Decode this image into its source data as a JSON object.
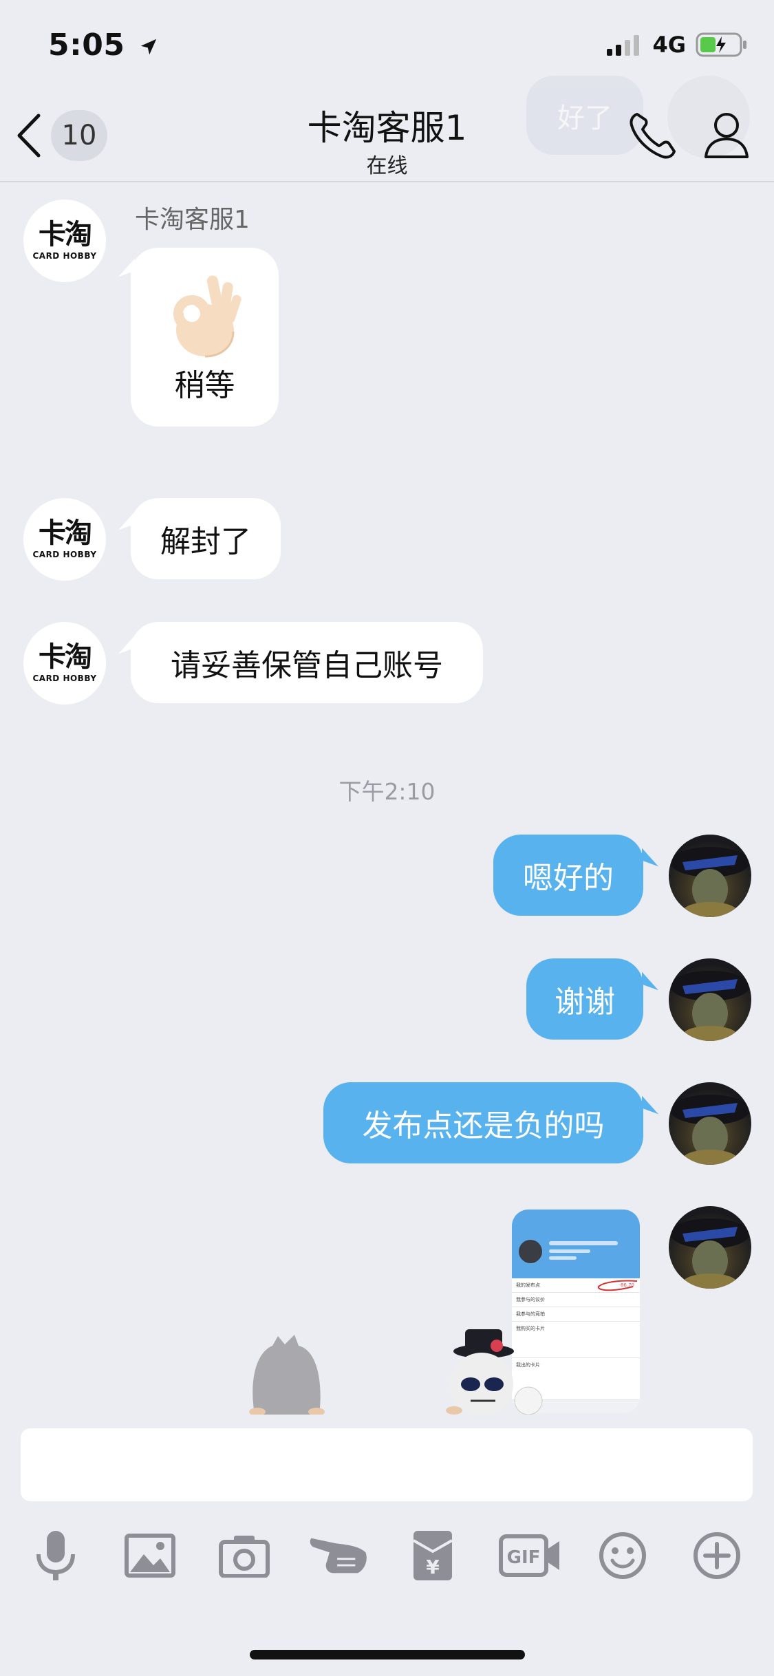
{
  "status_bar": {
    "time": "5:05",
    "network": "4G"
  },
  "header": {
    "unread_count": "10",
    "title": "卡淘客服1",
    "subtitle": "在线",
    "ghost_bubble_text": "好了"
  },
  "brand_logo": {
    "main": "卡淘",
    "sub": "CARD HOBBY"
  },
  "chat": {
    "incoming_sender": "卡淘客服1",
    "sticker_caption": "稍等",
    "msg_unsealed": "解封了",
    "msg_keep_account": "请妥善保管自己账号",
    "time_separator": "下午2:10",
    "msg_ok": "嗯好的",
    "msg_thanks": "谢谢",
    "msg_question": "发布点还是负的吗"
  },
  "thumbnail": {
    "rows": [
      "我的发布点",
      "我参与的议价",
      "我参与的竞拍",
      "我购买的卡片",
      "我出的卡片"
    ],
    "value": "-86.70"
  },
  "toolbar": {
    "icons": [
      "microphone-icon",
      "image-icon",
      "camera-icon",
      "point-hand-icon",
      "red-packet-icon",
      "gif-icon",
      "emoji-icon",
      "plus-icon"
    ],
    "red_packet_symbol": "¥",
    "gif_label": "GIF"
  },
  "colors": {
    "bubble_out": "#58b2ee",
    "bubble_in": "#ffffff",
    "background": "#ecedf2"
  }
}
